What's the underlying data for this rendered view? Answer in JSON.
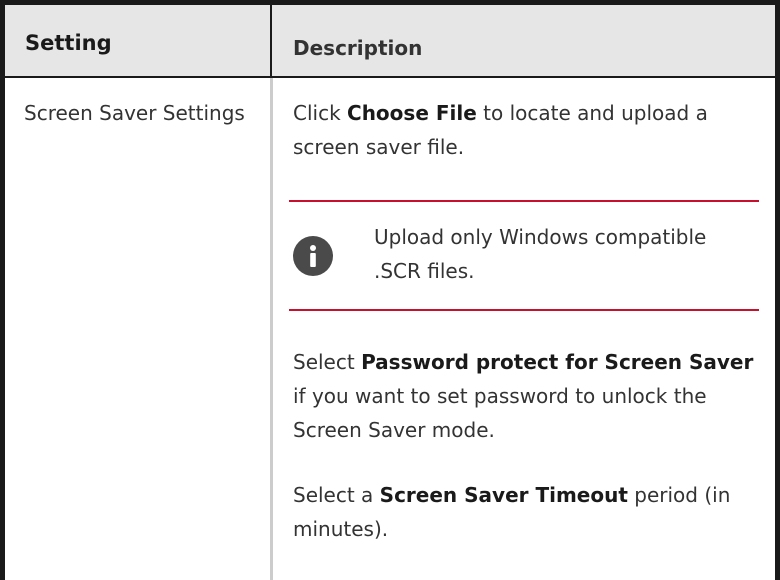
{
  "table": {
    "headers": {
      "setting": "Setting",
      "description": "Description"
    },
    "row": {
      "setting": "Screen Saver Settings",
      "p1": {
        "pre": "Click ",
        "bold": "Choose File",
        "post": " to locate and upload a screen saver file."
      },
      "note": {
        "icon": "info-icon",
        "text": "Upload only Windows compatible .SCR files."
      },
      "p2": {
        "pre": "Select ",
        "bold": "Password protect for Screen Saver",
        "post": " if you want to set password to unlock the Screen Saver mode."
      },
      "p3": {
        "pre": "Select a ",
        "bold": "Screen Saver Timeout",
        "post": " period (in minutes)."
      }
    }
  },
  "colors": {
    "header_bg": "#e6e6e6",
    "note_rule": "#c8102e",
    "border": "#1a1a1a"
  }
}
